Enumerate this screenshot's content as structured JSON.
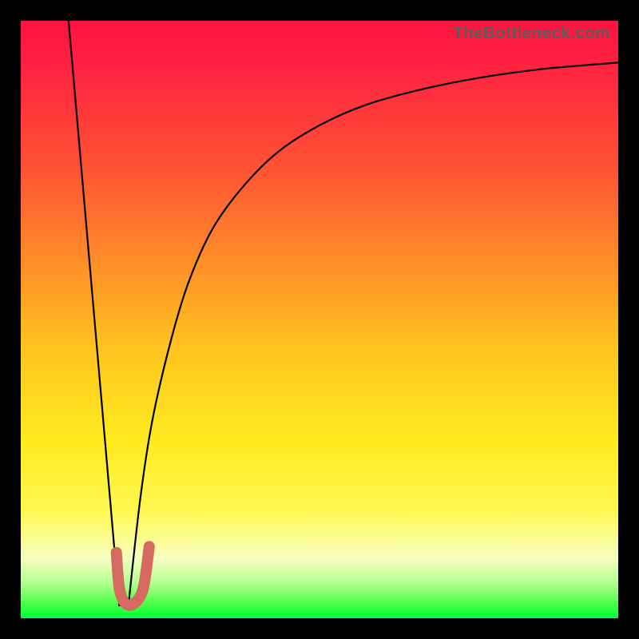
{
  "watermark": {
    "text": "TheBottleneck.com"
  },
  "chart_data": {
    "type": "line",
    "title": "",
    "xlabel": "",
    "ylabel": "",
    "xlim": [
      0,
      100
    ],
    "ylim": [
      0,
      100
    ],
    "grid": false,
    "series": [
      {
        "name": "descending-line",
        "x": [
          8,
          16.5
        ],
        "y": [
          100,
          2
        ]
      },
      {
        "name": "rising-curve",
        "x": [
          18,
          20,
          22,
          25,
          28,
          32,
          37,
          43,
          50,
          58,
          67,
          77,
          88,
          100
        ],
        "y": [
          2,
          20,
          33,
          46,
          56,
          65,
          72,
          78,
          82.5,
          86,
          88.5,
          90.5,
          92,
          93
        ]
      },
      {
        "name": "j-marker",
        "x": [
          16,
          16.5,
          17.5,
          19,
          20.5,
          21.5
        ],
        "y": [
          11,
          5,
          2.5,
          2.5,
          5,
          12
        ]
      }
    ],
    "colors": {
      "curve": "#000000",
      "marker": "#d46a60"
    }
  }
}
